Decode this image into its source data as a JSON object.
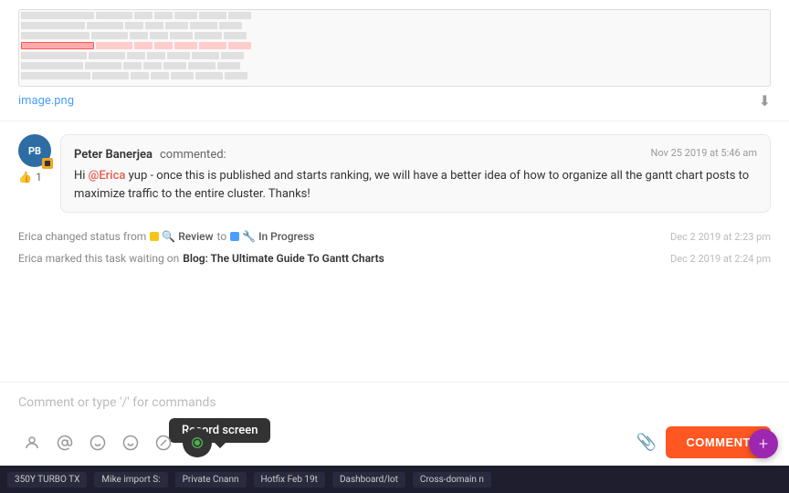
{
  "image": {
    "filename": "image.png",
    "download_tooltip": "Download"
  },
  "comment": {
    "author": "Peter Banerjea",
    "action": "commented:",
    "timestamp": "Nov 25 2019 at 5:46 am",
    "like_count": "1",
    "mention": "@Erica",
    "text_before": "Hi",
    "text_after": "yup - once this is published and starts ranking, we will have a better idea of how to organize all the gantt chart posts to maximize traffic to the entire cluster. Thanks!",
    "avatar_initials": "PB"
  },
  "activity": [
    {
      "user": "Erica",
      "action": "changed status from",
      "from_status": "Review",
      "to_label": "to",
      "to_status": "In Progress",
      "timestamp": "Dec 2 2019 at 2:23 pm"
    },
    {
      "user": "Erica",
      "action": "marked this task waiting on",
      "task": "Blog: The Ultimate Guide To Gantt Charts",
      "timestamp": "Dec 2 2019 at 2:24 pm"
    }
  ],
  "comment_input": {
    "placeholder": "Comment or type '/' for commands"
  },
  "toolbar": {
    "icons": [
      "person",
      "at",
      "emoji-face",
      "smiley",
      "slash",
      "record"
    ],
    "record_tooltip": "Record screen",
    "attach_label": "attach",
    "submit_label": "COMMENT"
  },
  "taskbar": {
    "items": [
      "350Y TURBO TX",
      "Mike import S:",
      "Private Cnann",
      "Hotfix Feb 19t",
      "Dashboard/lot",
      "Cross-domain n"
    ]
  }
}
